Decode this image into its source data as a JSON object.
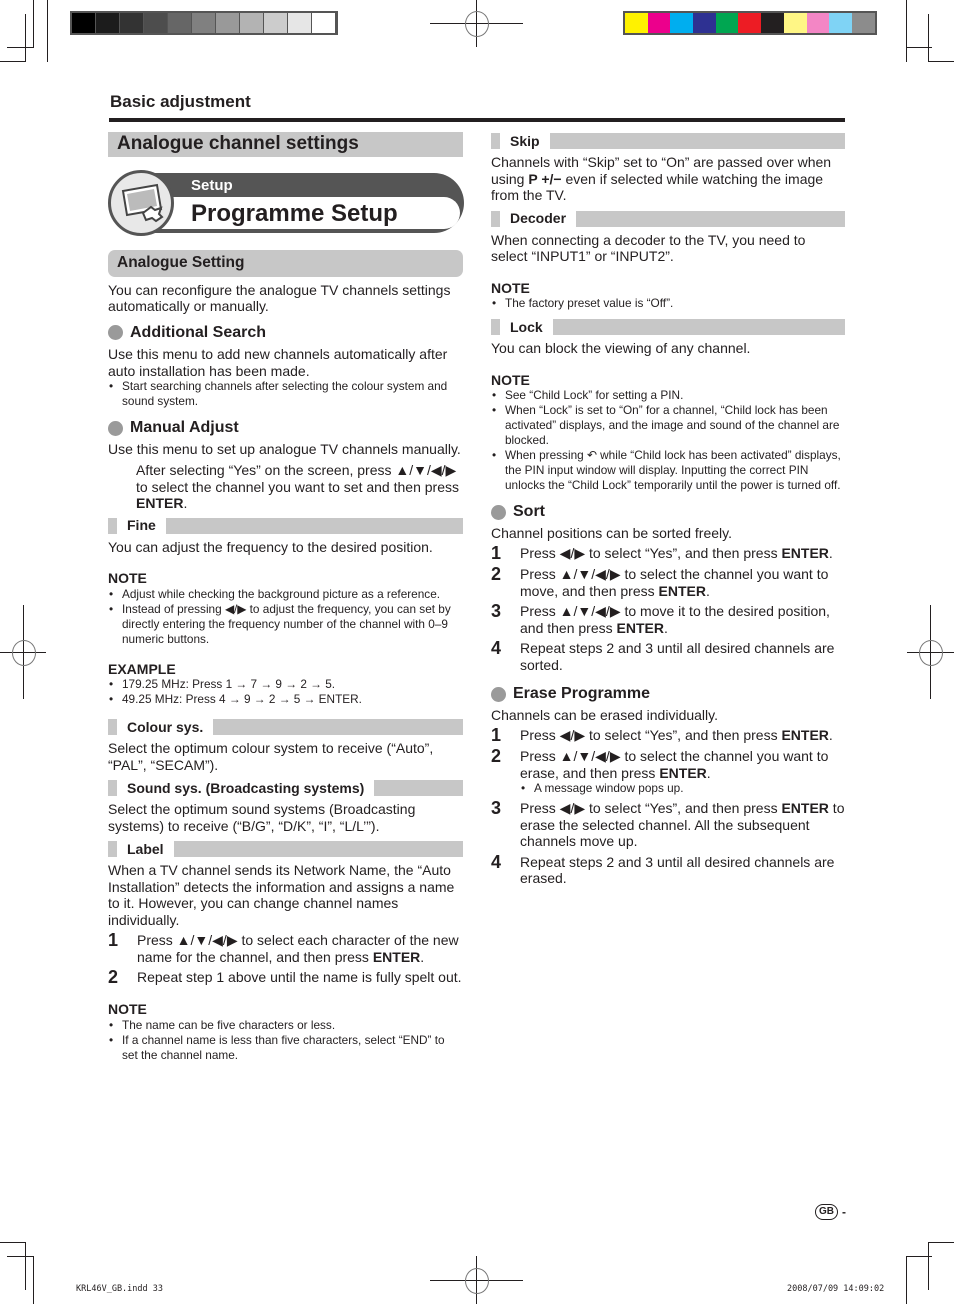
{
  "printer_marks": {
    "gray_swatches": [
      "#000000",
      "#1c1c1c",
      "#333333",
      "#4d4d4d",
      "#666666",
      "#808080",
      "#999999",
      "#b3b3b3",
      "#cccccc",
      "#e6e6e6",
      "#ffffff"
    ],
    "color_swatches": [
      "#fff200",
      "#ec008c",
      "#00aeef",
      "#2e3192",
      "#00a651",
      "#ed1c24",
      "#231f20",
      "#fff685",
      "#f386c5",
      "#7fd3f5",
      "#8c8c8c"
    ],
    "slug_left": "KRL46V_GB.indd   33",
    "slug_right": "2008/07/09   14:09:02"
  },
  "header": {
    "section": "Basic adjustment"
  },
  "page_marker": {
    "region": "GB",
    "dash": "-"
  },
  "left": {
    "title": "Analogue channel settings",
    "banner": {
      "category": "Setup",
      "title": "Programme Setup",
      "icon": "tv-wrench-icon"
    },
    "subsection": "Analogue Setting",
    "intro": "You can reconfigure the analogue TV channels settings automatically or manually.",
    "additional_search": {
      "heading": "Additional Search",
      "text": "Use this menu to add new channels automatically after auto installation has been made.",
      "bullet": "Start searching channels after selecting the colour system and sound system."
    },
    "manual_adjust": {
      "heading": "Manual Adjust",
      "text": "Use this menu to set up analogue TV channels manually.",
      "instruction_pre": "After selecting “Yes” on the screen, press ▲/▼/◀/▶ to select the channel you want to set and then press ",
      "instruction_bold": "ENTER",
      "instruction_post": "."
    },
    "fine": {
      "heading": "Fine",
      "text": "You can adjust the frequency to the desired position.",
      "note_label": "NOTE",
      "notes": [
        "Adjust while checking the background picture as a reference.",
        "Instead of pressing ◀/▶ to adjust the frequency, you can set by directly entering the frequency number of the channel with 0–9 numeric buttons."
      ],
      "example_label": "EXAMPLE",
      "examples": [
        "179.25 MHz: Press 1 → 7 → 9 → 2 → 5.",
        "49.25 MHz: Press 4 → 9 → 2 → 5 → ENTER."
      ]
    },
    "colour_sys": {
      "heading": "Colour sys.",
      "text": "Select the optimum colour system to receive (“Auto”, “PAL”, “SECAM”)."
    },
    "sound_sys": {
      "heading": "Sound sys. (Broadcasting systems)",
      "text": "Select the optimum sound systems (Broadcasting systems) to receive (“B/G”, “D/K”, “I”, “L/L’”)."
    },
    "label": {
      "heading": "Label",
      "text": "When a TV channel sends its Network Name, the “Auto Installation” detects the information and assigns a name to it. However, you can change channel names individually.",
      "steps": [
        {
          "num": "1",
          "pre": "Press ▲/▼/◀/▶ to select each character of the new name for the channel, and then press ",
          "bold": "ENTER",
          "post": "."
        },
        {
          "num": "2",
          "pre": "Repeat step 1 above until the name is fully spelt out.",
          "bold": "",
          "post": ""
        }
      ],
      "note_label": "NOTE",
      "notes": [
        "The name can be five characters or less.",
        "If a channel name is less than five characters, select “END” to set the channel name."
      ]
    }
  },
  "right": {
    "skip": {
      "heading": "Skip",
      "pre": "Channels with “Skip” set to “On” are passed over when using ",
      "bold": "P +/−",
      "post": " even if selected while watching the image from the TV."
    },
    "decoder": {
      "heading": "Decoder",
      "text": "When connecting a decoder to the TV, you need to select “INPUT1” or “INPUT2”.",
      "note_label": "NOTE",
      "notes": [
        "The factory preset value is “Off”."
      ]
    },
    "lock": {
      "heading": "Lock",
      "text": "You can block the viewing of any channel.",
      "note_label": "NOTE",
      "notes": [
        "See “Child Lock” for setting a PIN.",
        "When “Lock” is set to “On” for a channel, “Child lock has been activated” displays, and the image and sound of the channel are blocked.",
        "When pressing ↶ while “Child lock has been activated” displays, the PIN input window will display. Inputting the correct PIN unlocks the “Child Lock” temporarily until the power is turned off."
      ]
    },
    "sort": {
      "heading": "Sort",
      "text": "Channel positions can be sorted freely.",
      "steps": [
        {
          "num": "1",
          "pre": "Press ◀/▶ to select “Yes”, and then press ",
          "bold": "ENTER",
          "post": "."
        },
        {
          "num": "2",
          "pre": "Press ▲/▼/◀/▶ to select the channel you want to move, and then press ",
          "bold": "ENTER",
          "post": "."
        },
        {
          "num": "3",
          "pre": "Press ▲/▼/◀/▶ to move it to the desired position, and then press ",
          "bold": "ENTER",
          "post": "."
        },
        {
          "num": "4",
          "pre": "Repeat steps 2 and 3 until all desired channels are sorted.",
          "bold": "",
          "post": ""
        }
      ]
    },
    "erase": {
      "heading": "Erase Programme",
      "text": "Channels can be erased individually.",
      "steps": [
        {
          "num": "1",
          "pre": "Press ◀/▶ to select “Yes”, and then press ",
          "bold": "ENTER",
          "post": "."
        },
        {
          "num": "2",
          "pre": "Press ▲/▼/◀/▶ to select the channel you want to erase, and then press ",
          "bold": "ENTER",
          "post": "."
        },
        {
          "num": "3",
          "pre": "Press ◀/▶ to select “Yes”, and then press ",
          "bold": "ENTER",
          "post": " to erase the selected channel. All the subsequent channels move up."
        },
        {
          "num": "4",
          "pre": "Repeat steps 2 and 3 until all desired channels are erased.",
          "bold": "",
          "post": ""
        }
      ],
      "step2_bullet": "A message window pops up."
    }
  }
}
